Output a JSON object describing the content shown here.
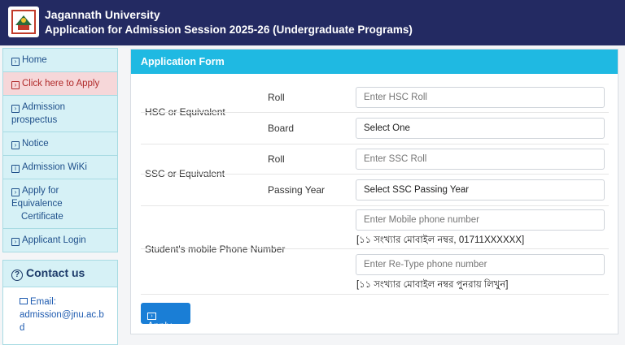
{
  "header": {
    "university": "Jagannath University",
    "title": "Application for Admission Session 2025-26 (Undergraduate Programs)",
    "background": "#232a62"
  },
  "sidebar": {
    "items": [
      {
        "label": "Home",
        "icon": "arrow-right-box-icon"
      },
      {
        "label": "Click here to Apply",
        "icon": "arrow-right-box-icon",
        "active": true
      },
      {
        "label": "Admission prospectus",
        "icon": "arrow-right-box-icon"
      },
      {
        "label": "Notice",
        "icon": "arrow-right-box-icon"
      },
      {
        "label": "Admission WiKi",
        "icon": "info-icon"
      },
      {
        "label": "Apply for Equivalence",
        "label2": "Certificate",
        "icon": "arrow-right-box-icon"
      },
      {
        "label": "Applicant Login",
        "icon": "arrow-right-box-icon"
      }
    ]
  },
  "contact": {
    "title": "Contact us",
    "email_label": "Email:",
    "email": "admission@jnu.ac.bd"
  },
  "form": {
    "title": "Application Form",
    "accent": "#1fb9e2",
    "hsc": {
      "label": "HSC or Equivalent",
      "roll_label": "Roll",
      "roll_placeholder": "Enter HSC Roll",
      "board_label": "Board",
      "board_value": "Select One"
    },
    "ssc": {
      "label": "SSC or Equivalent",
      "roll_label": "Roll",
      "roll_placeholder": "Enter SSC Roll",
      "year_label": "Passing Year",
      "year_value": "Select SSC Passing Year"
    },
    "mobile": {
      "label": "Student's mobile Phone Number",
      "placeholder": "Enter Mobile phone number",
      "hint": "[১১ সংখ্যার মোবাইল নম্বর, 01711XXXXXX]",
      "retype_placeholder": "Enter Re-Type phone number",
      "retype_hint": "[১১ সংখ্যার মোবাইল নম্বর পুনরায় লিখুন]"
    },
    "apply_button": "Apply"
  }
}
